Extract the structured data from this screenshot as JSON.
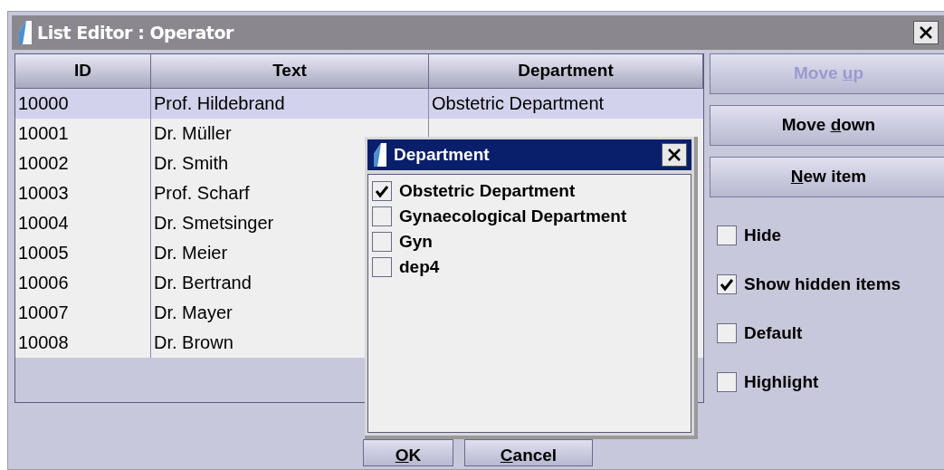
{
  "window": {
    "title": "List Editor : Operator"
  },
  "table": {
    "columns": [
      "ID",
      "Text",
      "Department"
    ],
    "rows": [
      {
        "id": "10000",
        "text": "Prof. Hildebrand",
        "department": "Obstetric Department",
        "selected": true
      },
      {
        "id": "10001",
        "text": "Dr. Müller",
        "selected": false
      },
      {
        "id": "10002",
        "text": "Dr. Smith",
        "selected": false
      },
      {
        "id": "10003",
        "text": "Prof. Scharf",
        "selected": false
      },
      {
        "id": "10004",
        "text": "Dr. Smetsinger",
        "selected": false
      },
      {
        "id": "10005",
        "text": "Dr. Meier",
        "selected": false
      },
      {
        "id": "10006",
        "text": "Dr. Bertrand",
        "selected": false
      },
      {
        "id": "10007",
        "text": "Dr. Mayer",
        "selected": false
      },
      {
        "id": "10008",
        "text": "Dr. Brown",
        "selected": false
      }
    ]
  },
  "side_buttons": [
    {
      "label": {
        "before": "Move ",
        "mnemonic": "u",
        "after": "p"
      },
      "disabled": true
    },
    {
      "label": {
        "before": "Move ",
        "mnemonic": "d",
        "after": "own"
      },
      "disabled": false
    },
    {
      "label": {
        "mnemonic": "N",
        "after": "ew item"
      },
      "disabled": false
    }
  ],
  "options": [
    {
      "label": "Hide",
      "checked": false
    },
    {
      "label": "Show hidden items",
      "checked": true
    },
    {
      "label": "Default",
      "checked": false
    },
    {
      "label": "Highlight",
      "checked": false
    }
  ],
  "dialog_buttons": [
    {
      "label": {
        "mnemonic": "O",
        "after": "K"
      }
    },
    {
      "label": {
        "mnemonic": "C",
        "after": "ancel"
      }
    }
  ],
  "popup": {
    "title": "Department",
    "items": [
      {
        "label": "Obstetric Department",
        "checked": true
      },
      {
        "label": "Gynaecological Department",
        "checked": false
      },
      {
        "label": "Gyn",
        "checked": false
      },
      {
        "label": "dep4",
        "checked": false
      }
    ]
  }
}
